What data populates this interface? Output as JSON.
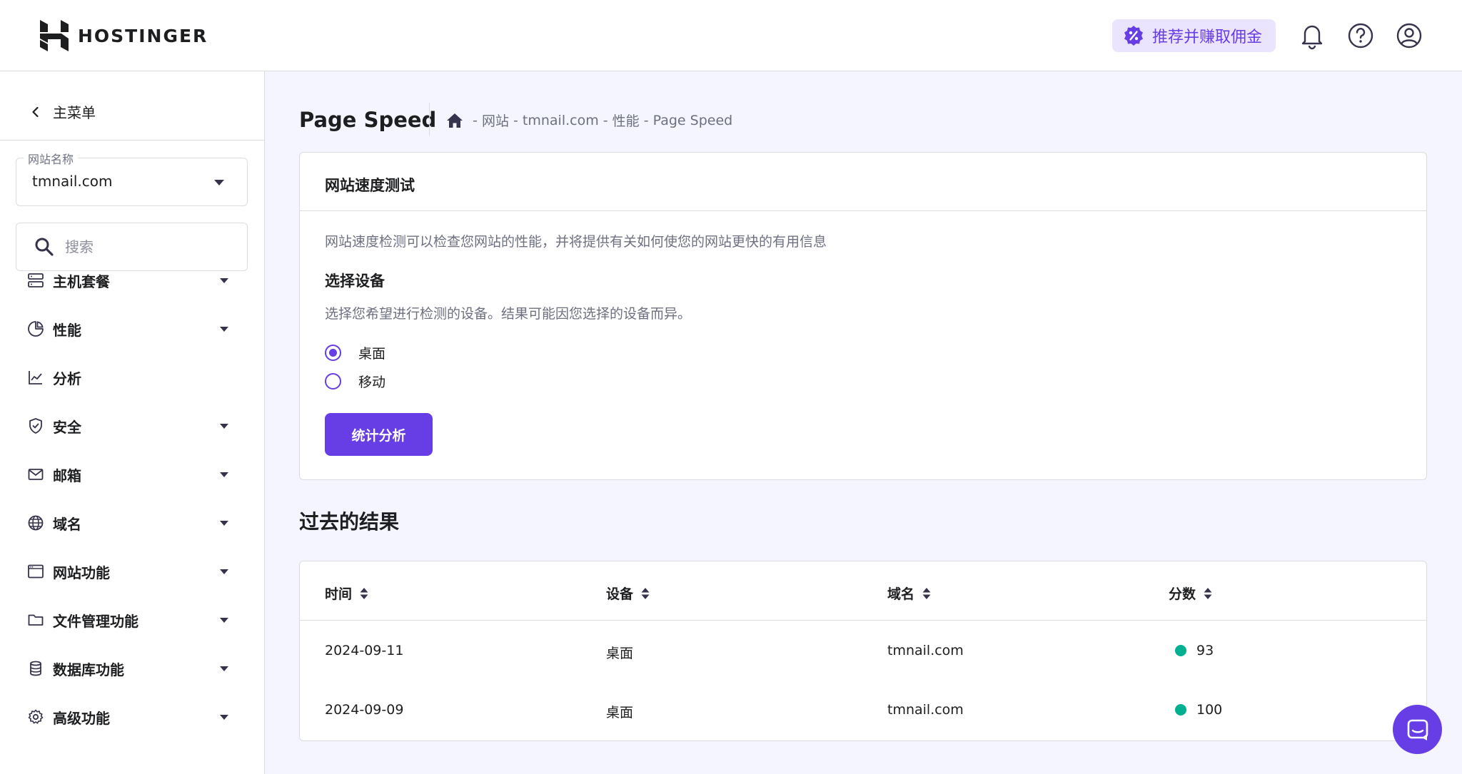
{
  "header": {
    "logo_text": "HOSTINGER",
    "referral_label": "推荐并赚取佣金",
    "icons": [
      "bell-icon",
      "help-icon",
      "account-icon"
    ]
  },
  "sidebar": {
    "back_label": "主菜单",
    "site_select": {
      "label": "网站名称",
      "value": "tmnail.com"
    },
    "search": {
      "placeholder": "搜索"
    },
    "items": [
      {
        "label": "主机套餐",
        "icon": "server-icon",
        "expandable": true
      },
      {
        "label": "性能",
        "icon": "pie-chart-icon",
        "expandable": true
      },
      {
        "label": "分析",
        "icon": "line-chart-icon",
        "expandable": false
      },
      {
        "label": "安全",
        "icon": "shield-icon",
        "expandable": true
      },
      {
        "label": "邮箱",
        "icon": "mail-icon",
        "expandable": true
      },
      {
        "label": "域名",
        "icon": "globe-icon",
        "expandable": true
      },
      {
        "label": "网站功能",
        "icon": "browser-window-icon",
        "expandable": true
      },
      {
        "label": "文件管理功能",
        "icon": "folder-icon",
        "expandable": true
      },
      {
        "label": "数据库功能",
        "icon": "database-icon",
        "expandable": true
      },
      {
        "label": "高级功能",
        "icon": "gear-icon",
        "expandable": true
      }
    ]
  },
  "main": {
    "page_title": "Page Speed",
    "breadcrumb": [
      "网站",
      "tmnail.com",
      "性能",
      "Page Speed"
    ],
    "speed_test": {
      "title": "网站速度测试",
      "description": "网站速度检测可以检查您网站的性能，并将提供有关如何使您的网站更快的有用信息",
      "device_title": "选择设备",
      "device_description": "选择您希望进行检测的设备。结果可能因您选择的设备而异。",
      "options": [
        {
          "label": "桌面",
          "selected": true
        },
        {
          "label": "移动",
          "selected": false
        }
      ],
      "button_label": "统计分析"
    },
    "past_results": {
      "title": "过去的结果",
      "columns": [
        "时间",
        "设备",
        "域名",
        "分数"
      ],
      "rows": [
        {
          "date": "2024-09-11",
          "device": "桌面",
          "domain": "tmnail.com",
          "score": "93"
        },
        {
          "date": "2024-09-09",
          "device": "桌面",
          "domain": "tmnail.com",
          "score": "100"
        }
      ]
    }
  },
  "colors": {
    "accent": "#673de6",
    "score_good": "#00b090",
    "background": "#f4f5ff"
  }
}
